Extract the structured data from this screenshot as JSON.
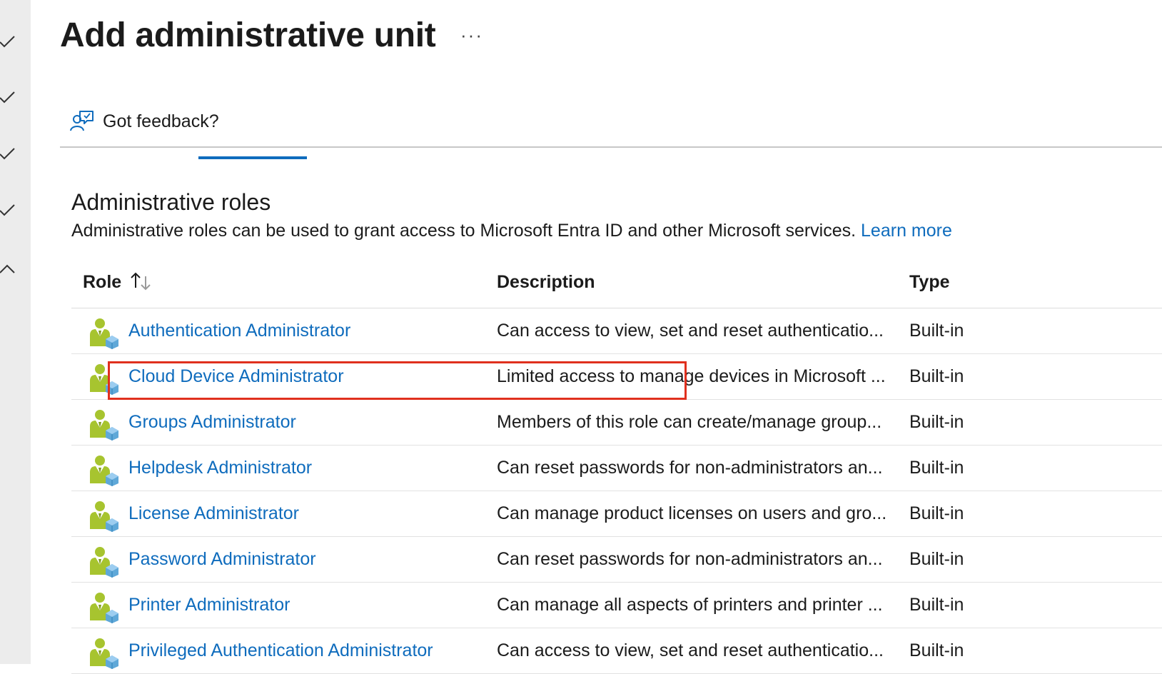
{
  "header": {
    "title": "Add administrative unit",
    "more_label": "···"
  },
  "toolbar": {
    "feedback_label": "Got feedback?"
  },
  "section": {
    "title": "Administrative roles",
    "description": "Administrative roles can be used to grant access to Microsoft Entra ID and other Microsoft services.",
    "learn_more": "Learn more"
  },
  "table": {
    "columns": {
      "role": "Role",
      "description": "Description",
      "type": "Type"
    },
    "rows": [
      {
        "role": "Authentication Administrator",
        "description": "Can access to view, set and reset authenticatio...",
        "type": "Built-in"
      },
      {
        "role": "Cloud Device Administrator",
        "description": "Limited access to manage devices in Microsoft ...",
        "type": "Built-in"
      },
      {
        "role": "Groups Administrator",
        "description": "Members of this role can create/manage group...",
        "type": "Built-in"
      },
      {
        "role": "Helpdesk Administrator",
        "description": "Can reset passwords for non-administrators an...",
        "type": "Built-in"
      },
      {
        "role": "License Administrator",
        "description": "Can manage product licenses on users and gro...",
        "type": "Built-in"
      },
      {
        "role": "Password Administrator",
        "description": "Can reset passwords for non-administrators an...",
        "type": "Built-in"
      },
      {
        "role": "Printer Administrator",
        "description": "Can manage all aspects of printers and printer ...",
        "type": "Built-in"
      },
      {
        "role": "Privileged Authentication Administrator",
        "description": "Can access to view, set and reset authenticatio...",
        "type": "Built-in"
      }
    ]
  },
  "icons": {
    "rail": [
      "check-icon",
      "check-icon",
      "check-icon",
      "check-icon",
      "chevron-up-icon"
    ],
    "feedback": "feedback-person-icon",
    "role": "role-admin-icon",
    "sort": "sort-icon"
  },
  "colors": {
    "link": "#0f6cbd",
    "highlight": "#e0301e",
    "tab_indicator": "#0f6cbd"
  }
}
